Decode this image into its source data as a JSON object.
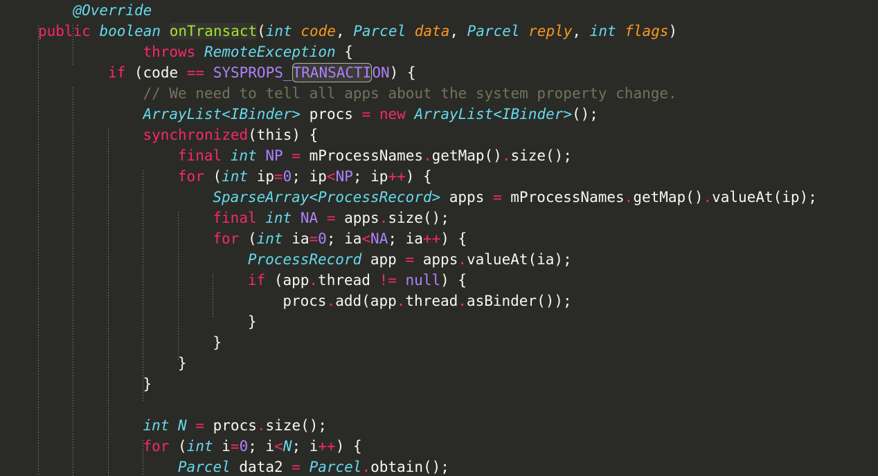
{
  "editor": {
    "name": "source-code-editor",
    "language": "Java",
    "colors": {
      "background": "#2a2b26",
      "keyword": "#f92672",
      "type": "#66d9ef",
      "function": "#a6e22e",
      "parameter": "#fd971f",
      "number": "#ae81ff",
      "constant": "#ae81ff",
      "comment": "#75715e",
      "plain": "#f8f8f2",
      "indent_guide": "#6b6a5e",
      "selection_border": "#b5b3a6",
      "selection_fill": "#3a3b34",
      "function_highlight": "#34352f"
    },
    "indent_guide_columns": [
      55,
      111,
      167,
      223,
      279,
      334
    ],
    "selected_text": "TRANSACTI",
    "highlighted_symbol": "onTransact",
    "lines": [
      {
        "n": 1,
        "indent": 1,
        "tokens": [
          {
            "t": "@Override",
            "c": "ann"
          }
        ]
      },
      {
        "n": 2,
        "indent": 0,
        "tokens": [
          {
            "t": "public",
            "c": "kw"
          },
          {
            "t": " ",
            "c": "pln"
          },
          {
            "t": "boolean",
            "c": "type"
          },
          {
            "t": " ",
            "c": "pln"
          },
          {
            "t": "onTransact",
            "c": "fn",
            "hl": true
          },
          {
            "t": "(",
            "c": "pln"
          },
          {
            "t": "int",
            "c": "type"
          },
          {
            "t": " ",
            "c": "pln"
          },
          {
            "t": "code",
            "c": "param"
          },
          {
            "t": ", ",
            "c": "pln"
          },
          {
            "t": "Parcel",
            "c": "type"
          },
          {
            "t": " ",
            "c": "pln"
          },
          {
            "t": "data",
            "c": "param"
          },
          {
            "t": ", ",
            "c": "pln"
          },
          {
            "t": "Parcel",
            "c": "type"
          },
          {
            "t": " ",
            "c": "pln"
          },
          {
            "t": "reply",
            "c": "param"
          },
          {
            "t": ", ",
            "c": "pln"
          },
          {
            "t": "int",
            "c": "type"
          },
          {
            "t": " ",
            "c": "pln"
          },
          {
            "t": "flags",
            "c": "param"
          },
          {
            "t": ")",
            "c": "pln"
          }
        ]
      },
      {
        "n": 3,
        "indent": 3,
        "tokens": [
          {
            "t": "throws",
            "c": "kw"
          },
          {
            "t": " ",
            "c": "pln"
          },
          {
            "t": "RemoteException",
            "c": "type"
          },
          {
            "t": " {",
            "c": "pln"
          }
        ]
      },
      {
        "n": 4,
        "indent": 2,
        "tokens": [
          {
            "t": "if",
            "c": "kw"
          },
          {
            "t": " (code ",
            "c": "pln"
          },
          {
            "t": "==",
            "c": "op"
          },
          {
            "t": " ",
            "c": "pln"
          },
          {
            "t": "SYSPROPS_",
            "c": "const"
          },
          {
            "t": "TRANSACTI",
            "c": "const",
            "sel": true
          },
          {
            "t": "ON",
            "c": "const"
          },
          {
            "t": ") {",
            "c": "pln"
          }
        ]
      },
      {
        "n": 5,
        "indent": 3,
        "tokens": [
          {
            "t": "// We need to tell all apps about the system property change.",
            "c": "cmt"
          }
        ]
      },
      {
        "n": 6,
        "indent": 3,
        "tokens": [
          {
            "t": "ArrayList<IBinder>",
            "c": "type"
          },
          {
            "t": " procs ",
            "c": "pln"
          },
          {
            "t": "=",
            "c": "op"
          },
          {
            "t": " ",
            "c": "pln"
          },
          {
            "t": "new",
            "c": "kw"
          },
          {
            "t": " ",
            "c": "pln"
          },
          {
            "t": "ArrayList<IBinder>",
            "c": "type"
          },
          {
            "t": "();",
            "c": "pln"
          }
        ]
      },
      {
        "n": 7,
        "indent": 3,
        "tokens": [
          {
            "t": "synchronized",
            "c": "kw"
          },
          {
            "t": "(this) {",
            "c": "pln"
          }
        ]
      },
      {
        "n": 8,
        "indent": 4,
        "tokens": [
          {
            "t": "final",
            "c": "kw"
          },
          {
            "t": " ",
            "c": "pln"
          },
          {
            "t": "int",
            "c": "type"
          },
          {
            "t": " ",
            "c": "pln"
          },
          {
            "t": "NP",
            "c": "const"
          },
          {
            "t": " ",
            "c": "pln"
          },
          {
            "t": "=",
            "c": "op"
          },
          {
            "t": " mProcessNames",
            "c": "pln"
          },
          {
            "t": ".",
            "c": "op"
          },
          {
            "t": "getMap()",
            "c": "pln"
          },
          {
            "t": ".",
            "c": "op"
          },
          {
            "t": "size();",
            "c": "pln"
          }
        ]
      },
      {
        "n": 9,
        "indent": 4,
        "tokens": [
          {
            "t": "for",
            "c": "kw"
          },
          {
            "t": " (",
            "c": "pln"
          },
          {
            "t": "int",
            "c": "type"
          },
          {
            "t": " ip",
            "c": "pln"
          },
          {
            "t": "=",
            "c": "op"
          },
          {
            "t": "0",
            "c": "num"
          },
          {
            "t": "; ip",
            "c": "pln"
          },
          {
            "t": "<",
            "c": "op"
          },
          {
            "t": "NP",
            "c": "const"
          },
          {
            "t": "; ip",
            "c": "pln"
          },
          {
            "t": "++",
            "c": "op"
          },
          {
            "t": ") {",
            "c": "pln"
          }
        ]
      },
      {
        "n": 10,
        "indent": 5,
        "tokens": [
          {
            "t": "SparseArray<ProcessRecord>",
            "c": "type"
          },
          {
            "t": " apps ",
            "c": "pln"
          },
          {
            "t": "=",
            "c": "op"
          },
          {
            "t": " mProcessNames",
            "c": "pln"
          },
          {
            "t": ".",
            "c": "op"
          },
          {
            "t": "getMap()",
            "c": "pln"
          },
          {
            "t": ".",
            "c": "op"
          },
          {
            "t": "valueAt(ip);",
            "c": "pln"
          }
        ]
      },
      {
        "n": 11,
        "indent": 5,
        "tokens": [
          {
            "t": "final",
            "c": "kw"
          },
          {
            "t": " ",
            "c": "pln"
          },
          {
            "t": "int",
            "c": "type"
          },
          {
            "t": " ",
            "c": "pln"
          },
          {
            "t": "NA",
            "c": "const"
          },
          {
            "t": " ",
            "c": "pln"
          },
          {
            "t": "=",
            "c": "op"
          },
          {
            "t": " apps",
            "c": "pln"
          },
          {
            "t": ".",
            "c": "op"
          },
          {
            "t": "size();",
            "c": "pln"
          }
        ]
      },
      {
        "n": 12,
        "indent": 5,
        "tokens": [
          {
            "t": "for",
            "c": "kw"
          },
          {
            "t": " (",
            "c": "pln"
          },
          {
            "t": "int",
            "c": "type"
          },
          {
            "t": " ia",
            "c": "pln"
          },
          {
            "t": "=",
            "c": "op"
          },
          {
            "t": "0",
            "c": "num"
          },
          {
            "t": "; ia",
            "c": "pln"
          },
          {
            "t": "<",
            "c": "op"
          },
          {
            "t": "NA",
            "c": "const"
          },
          {
            "t": "; ia",
            "c": "pln"
          },
          {
            "t": "++",
            "c": "op"
          },
          {
            "t": ") {",
            "c": "pln"
          }
        ]
      },
      {
        "n": 13,
        "indent": 6,
        "tokens": [
          {
            "t": "ProcessRecord",
            "c": "type"
          },
          {
            "t": " app ",
            "c": "pln"
          },
          {
            "t": "=",
            "c": "op"
          },
          {
            "t": " apps",
            "c": "pln"
          },
          {
            "t": ".",
            "c": "op"
          },
          {
            "t": "valueAt(ia);",
            "c": "pln"
          }
        ]
      },
      {
        "n": 14,
        "indent": 6,
        "tokens": [
          {
            "t": "if",
            "c": "kw"
          },
          {
            "t": " (app",
            "c": "pln"
          },
          {
            "t": ".",
            "c": "op"
          },
          {
            "t": "thread ",
            "c": "pln"
          },
          {
            "t": "!=",
            "c": "op"
          },
          {
            "t": " ",
            "c": "pln"
          },
          {
            "t": "null",
            "c": "const"
          },
          {
            "t": ") {",
            "c": "pln"
          }
        ]
      },
      {
        "n": 15,
        "indent": 7,
        "tokens": [
          {
            "t": "procs",
            "c": "pln"
          },
          {
            "t": ".",
            "c": "op"
          },
          {
            "t": "add(app",
            "c": "pln"
          },
          {
            "t": ".",
            "c": "op"
          },
          {
            "t": "thread",
            "c": "pln"
          },
          {
            "t": ".",
            "c": "op"
          },
          {
            "t": "asBinder());",
            "c": "pln"
          }
        ]
      },
      {
        "n": 16,
        "indent": 6,
        "tokens": [
          {
            "t": "}",
            "c": "pln"
          }
        ]
      },
      {
        "n": 17,
        "indent": 5,
        "tokens": [
          {
            "t": "}",
            "c": "pln"
          }
        ]
      },
      {
        "n": 18,
        "indent": 4,
        "tokens": [
          {
            "t": "}",
            "c": "pln"
          }
        ]
      },
      {
        "n": 19,
        "indent": 3,
        "tokens": [
          {
            "t": "}",
            "c": "pln"
          }
        ]
      },
      {
        "n": 20,
        "indent": 0,
        "tokens": []
      },
      {
        "n": 21,
        "indent": 3,
        "tokens": [
          {
            "t": "int",
            "c": "type"
          },
          {
            "t": " ",
            "c": "pln"
          },
          {
            "t": "N",
            "c": "type"
          },
          {
            "t": " ",
            "c": "pln"
          },
          {
            "t": "=",
            "c": "op"
          },
          {
            "t": " procs",
            "c": "pln"
          },
          {
            "t": ".",
            "c": "op"
          },
          {
            "t": "size();",
            "c": "pln"
          }
        ]
      },
      {
        "n": 22,
        "indent": 3,
        "tokens": [
          {
            "t": "for",
            "c": "kw"
          },
          {
            "t": " (",
            "c": "pln"
          },
          {
            "t": "int",
            "c": "type"
          },
          {
            "t": " i",
            "c": "pln"
          },
          {
            "t": "=",
            "c": "op"
          },
          {
            "t": "0",
            "c": "num"
          },
          {
            "t": "; i",
            "c": "pln"
          },
          {
            "t": "<",
            "c": "op"
          },
          {
            "t": "N",
            "c": "type"
          },
          {
            "t": "; i",
            "c": "pln"
          },
          {
            "t": "++",
            "c": "op"
          },
          {
            "t": ") {",
            "c": "pln"
          }
        ]
      },
      {
        "n": 23,
        "indent": 4,
        "tokens": [
          {
            "t": "Parcel",
            "c": "type"
          },
          {
            "t": " data2 ",
            "c": "pln"
          },
          {
            "t": "=",
            "c": "op"
          },
          {
            "t": " ",
            "c": "pln"
          },
          {
            "t": "Parcel",
            "c": "type"
          },
          {
            "t": ".",
            "c": "op"
          },
          {
            "t": "obtain();",
            "c": "pln"
          }
        ]
      }
    ]
  }
}
